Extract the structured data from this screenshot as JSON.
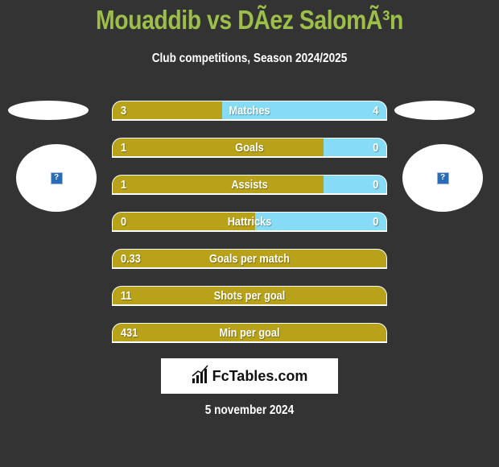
{
  "header": {
    "title": "Mouaddib vs DÃez SalomÃ³n",
    "subtitle": "Club competitions, Season 2024/2025"
  },
  "players": {
    "left": {
      "logo_icon": "broken-image-icon",
      "logo_glyph": "?"
    },
    "right": {
      "logo_icon": "broken-image-icon",
      "logo_glyph": "?"
    }
  },
  "colors": {
    "left_bar": "#b8a21a",
    "right_bar": "#87dcf5",
    "title": "#9dbf4a",
    "background": "#333333"
  },
  "stats": [
    {
      "label": "Matches",
      "left": "3",
      "right": "4",
      "left_share": 0.4
    },
    {
      "label": "Goals",
      "left": "1",
      "right": "0",
      "left_share": 0.77
    },
    {
      "label": "Assists",
      "left": "1",
      "right": "0",
      "left_share": 0.77
    },
    {
      "label": "Hattricks",
      "left": "0",
      "right": "0",
      "left_share": 0.52
    },
    {
      "label": "Goals per match",
      "left": "0.33",
      "right": "",
      "left_share": 1.0
    },
    {
      "label": "Shots per goal",
      "left": "11",
      "right": "",
      "left_share": 1.0
    },
    {
      "label": "Min per goal",
      "left": "431",
      "right": "",
      "left_share": 1.0
    }
  ],
  "footer": {
    "brand": "FcTables.com",
    "brand_icon": "bar-chart-icon",
    "date": "5 november 2024"
  }
}
